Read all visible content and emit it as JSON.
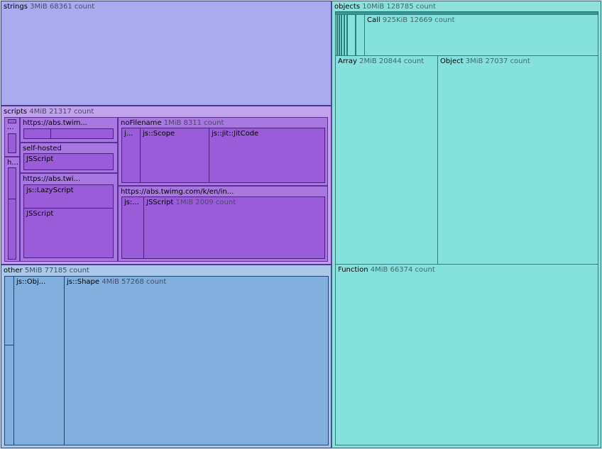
{
  "strings": {
    "name": "strings",
    "meta": "3MiB 68361 count"
  },
  "scripts": {
    "name": "scripts",
    "meta": "4MiB 21317 count",
    "ellipsis_small": "...",
    "h_label": "h...",
    "abs_twim": {
      "name": "https://abs.twim..."
    },
    "self_hosted": {
      "name": "self-hosted",
      "child": "JSScript"
    },
    "abs_twi": {
      "name": "https://abs.twi...",
      "lazy": "js::LazyScript",
      "jsscript": "JSScript"
    },
    "no_filename": {
      "name": "noFilename",
      "meta": "1MiB 8311 count",
      "j": "j...",
      "scope": "js::Scope",
      "jitcode": "js::jit::JitCode"
    },
    "abs_twimg_en": {
      "name": "https://abs.twimg.com/k/en/in...",
      "js": "js:...",
      "jsscript": "JSScript",
      "jsscript_meta": "1MiB 2009 count"
    }
  },
  "other": {
    "name": "other",
    "meta": "5MiB 77185 count",
    "jsobj": "js::Obj...",
    "shape": "js::Shape",
    "shape_meta": "4MiB 57268 count"
  },
  "objects": {
    "name": "objects",
    "meta": "10MiB 128785 count",
    "call": "Call",
    "call_meta": "925KiB 12669 count",
    "array": "Array",
    "array_meta": "2MiB 20844 count",
    "object": "Object",
    "object_meta": "3MiB 27037 count",
    "function": "Function",
    "function_meta": "4MiB 66374 count"
  },
  "colors": {
    "strings": "#abaaee",
    "scripts": "#c0a3ec",
    "scripts_leaf": "#9a5cd8",
    "other": "#a9c8ea",
    "other_leaf": "#82b0de",
    "objects": "#8ee0dc"
  }
}
